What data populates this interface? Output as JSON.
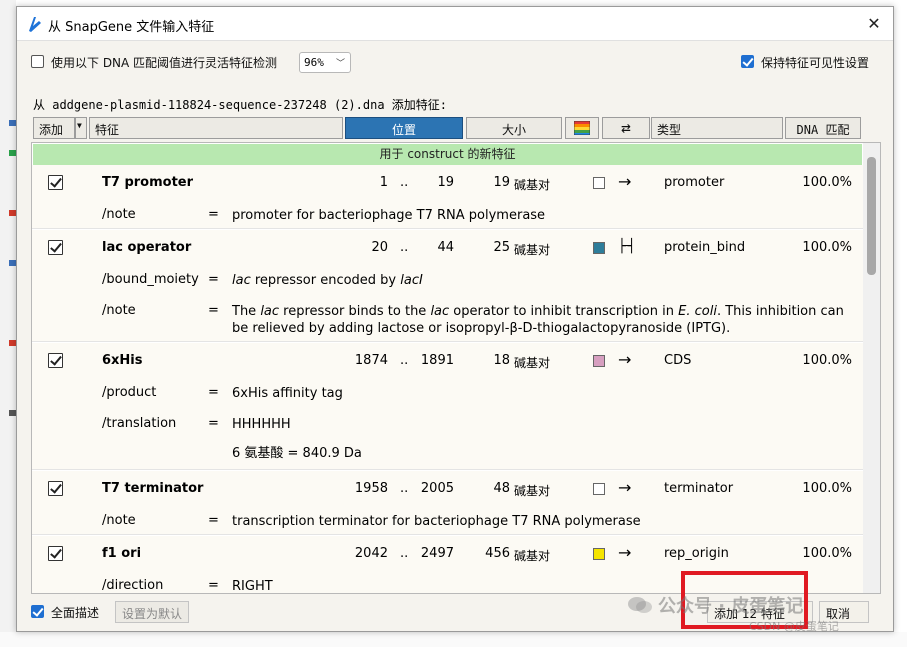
{
  "window": {
    "title": "从 SnapGene 文件输入特征",
    "close_icon": "close-icon"
  },
  "options": {
    "flex_detect_label": "使用以下 DNA 匹配阈值进行灵活特征检测",
    "flex_detect_checked": false,
    "threshold_value": "96%",
    "keep_visibility_label": "保持特征可见性设置",
    "keep_visibility_checked": true
  },
  "source_line": "从 addgene-plasmid-118824-sequence-237248 (2).dna 添加特征:",
  "header": {
    "add_label": "添加",
    "feature_col": "特征",
    "position_col": "位置",
    "size_col": "大小",
    "type_col": "类型",
    "dna_match_col": "DNA 匹配",
    "color_icon": "color-palette-icon",
    "direction_icon": "swap-arrows-icon"
  },
  "banner": "用于 construct 的新特征",
  "features": [
    {
      "name": "T7 promoter",
      "start": "1",
      "dots": "..",
      "end": "19",
      "length": "19",
      "unit": "碱基对",
      "color": "#ffffff",
      "direction": "→",
      "type": "promoter",
      "match": "100.0%",
      "qualifiers": [
        {
          "key": "/note",
          "eq": "=",
          "value": "promoter for bacteriophage T7 RNA polymerase"
        }
      ]
    },
    {
      "name": "lac operator",
      "start": "20",
      "dots": "..",
      "end": "44",
      "length": "25",
      "unit": "碱基对",
      "color": "#2e7d9a",
      "direction": "⊢⊣",
      "type": "protein_bind",
      "match": "100.0%",
      "qualifiers": [
        {
          "key": "/bound_moiety",
          "eq": "=",
          "value": "lac repressor encoded by lacI"
        },
        {
          "key": "/note",
          "eq": "=",
          "value": "The lac repressor binds to the lac operator to inhibit transcription in E. coli. This inhibition can be relieved by adding lactose or isopropyl-β-D-thiogalactopyranoside (IPTG)."
        }
      ]
    },
    {
      "name": "6xHis",
      "start": "1874",
      "dots": "..",
      "end": "1891",
      "length": "18",
      "unit": "碱基对",
      "color": "#d79fc0",
      "direction": "→",
      "type": "CDS",
      "match": "100.0%",
      "qualifiers": [
        {
          "key": "/product",
          "eq": "=",
          "value": "6xHis affinity tag"
        },
        {
          "key": "/translation",
          "eq": "=",
          "value": "HHHHHH"
        },
        {
          "key": "",
          "eq": "",
          "value": "6 氨基酸  =  840.9 Da"
        }
      ]
    },
    {
      "name": "T7 terminator",
      "start": "1958",
      "dots": "..",
      "end": "2005",
      "length": "48",
      "unit": "碱基对",
      "color": "#ffffff",
      "direction": "→",
      "type": "terminator",
      "match": "100.0%",
      "qualifiers": [
        {
          "key": "/note",
          "eq": "=",
          "value": "transcription terminator for bacteriophage T7 RNA polymerase"
        }
      ]
    },
    {
      "name": "f1 ori",
      "start": "2042",
      "dots": "..",
      "end": "2497",
      "length": "456",
      "unit": "碱基对",
      "color": "#f5e400",
      "direction": "→",
      "type": "rep_origin",
      "match": "100.0%",
      "qualifiers": [
        {
          "key": "/direction",
          "eq": "=",
          "value": "RIGHT"
        }
      ]
    }
  ],
  "footer": {
    "full_desc_label": "全面描述",
    "full_desc_checked": true,
    "set_default_label": "设置为默认",
    "add_button_label": "添加 12 特征",
    "cancel_label": "取消"
  },
  "watermark": {
    "text": "公众号 · 皮蛋笔记",
    "sub": "CSDN @皮蛋笔记"
  }
}
